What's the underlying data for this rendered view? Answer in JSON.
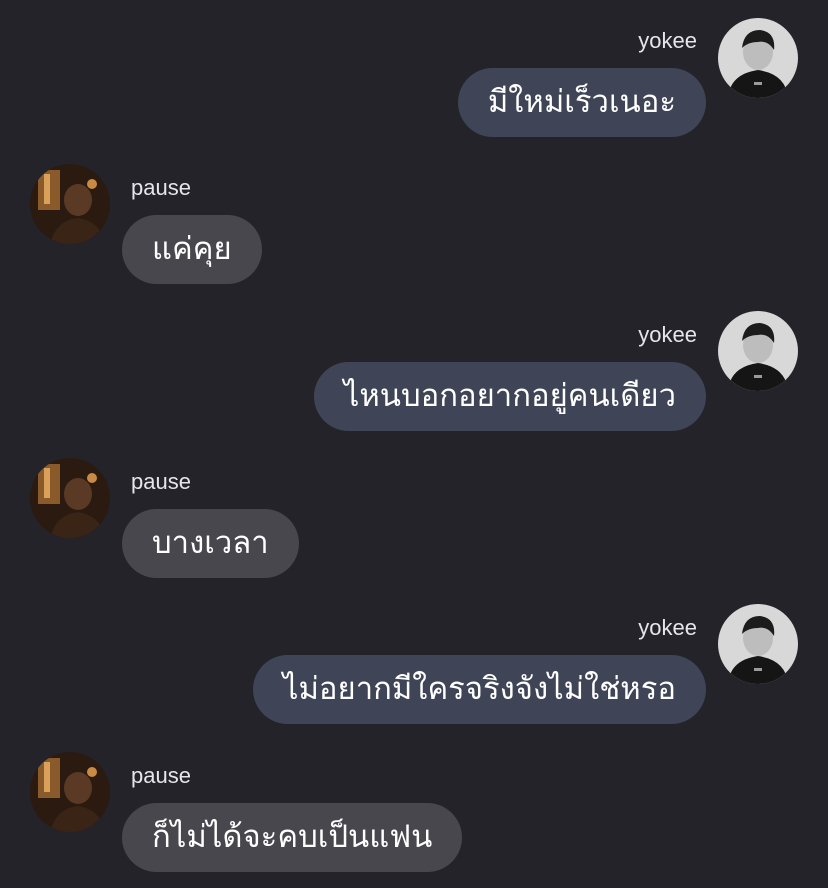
{
  "conversation": {
    "messages": [
      {
        "sender": "yokee",
        "side": "right",
        "text": "มีใหม่เร็วเนอะ",
        "avatar": "yokee-avatar"
      },
      {
        "sender": "pause",
        "side": "left",
        "text": "แค่คุย",
        "avatar": "pause-avatar"
      },
      {
        "sender": "yokee",
        "side": "right",
        "text": "ไหนบอกอยากอยู่คนเดียว",
        "avatar": "yokee-avatar"
      },
      {
        "sender": "pause",
        "side": "left",
        "text": "บางเวลา",
        "avatar": "pause-avatar"
      },
      {
        "sender": "yokee",
        "side": "right",
        "text": "ไม่อยากมีใครจริงจังไม่ใช่หรอ",
        "avatar": "yokee-avatar"
      },
      {
        "sender": "pause",
        "side": "left",
        "text": "ก็ไม่ได้จะคบเป็นแฟน",
        "avatar": "pause-avatar"
      }
    ]
  },
  "colors": {
    "background": "#232329",
    "outgoing_bubble": "#3f4556",
    "incoming_bubble": "#47474d",
    "text": "#ffffff",
    "sender_name": "#e6e6ea"
  }
}
